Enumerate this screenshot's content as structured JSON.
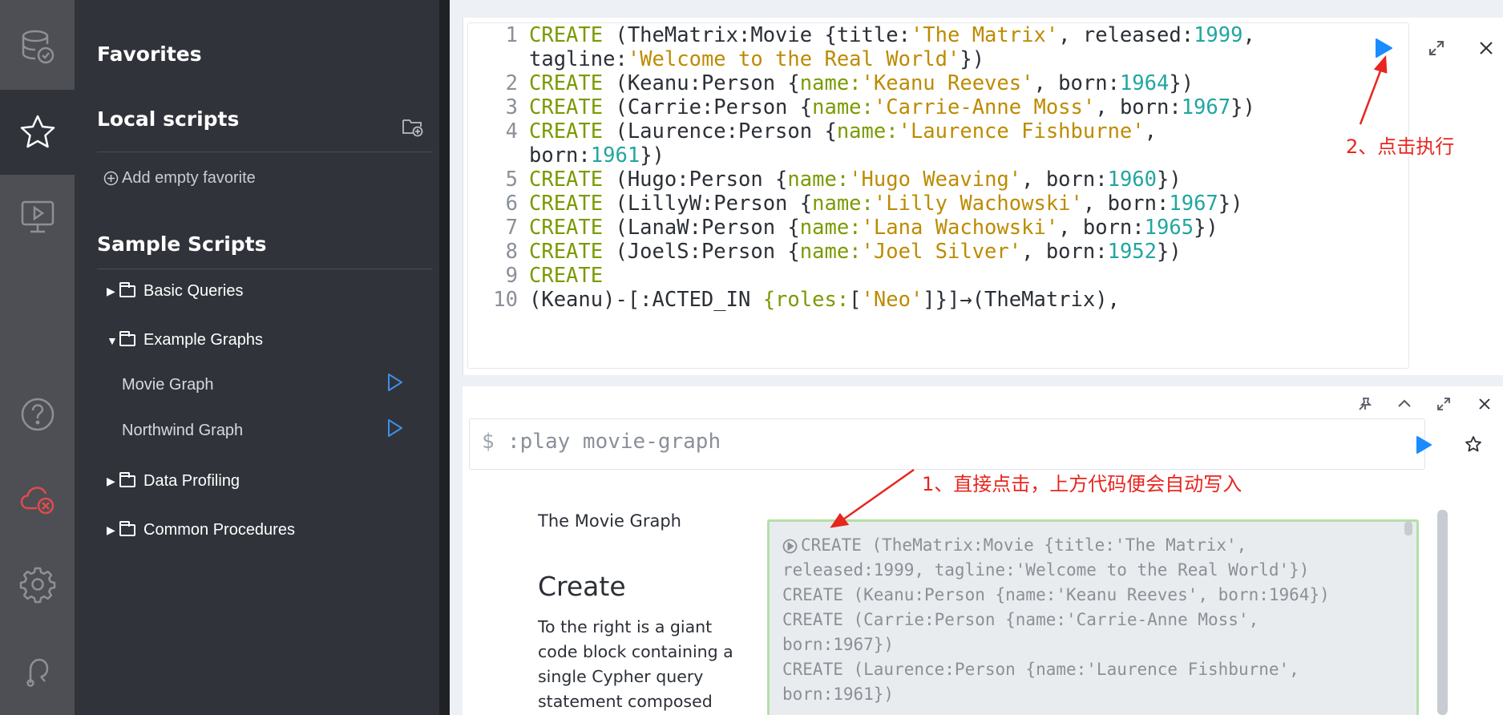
{
  "sidebar": {
    "favorites_title": "Favorites",
    "local_scripts_title": "Local scripts",
    "add_empty_favorite": "Add empty favorite",
    "sample_scripts_title": "Sample Scripts",
    "folders": [
      {
        "label": "Basic Queries",
        "expanded": false
      },
      {
        "label": "Example Graphs",
        "expanded": true
      },
      {
        "label": "Data Profiling",
        "expanded": false
      },
      {
        "label": "Common Procedures",
        "expanded": false
      }
    ],
    "scripts": [
      {
        "label": "Movie Graph"
      },
      {
        "label": "Northwind Graph"
      }
    ]
  },
  "rail": {
    "icons": [
      "database-icon",
      "star-icon",
      "monitor-play-icon",
      "help-icon",
      "cloud-disconnected-icon",
      "settings-gear-icon",
      "plug-icon"
    ],
    "active": "star-icon",
    "alert_color": "#e34b4b"
  },
  "editor": {
    "lines": [
      {
        "n": "1",
        "parts": [
          [
            "kw",
            "CREATE"
          ],
          [
            "t",
            " (TheMatrix:Movie {title:"
          ],
          [
            "str",
            "'The Matrix'"
          ],
          [
            "t",
            ", released:"
          ],
          [
            "num",
            "1999"
          ],
          [
            "t",
            ","
          ]
        ]
      },
      {
        "n": "",
        "parts": [
          [
            "t",
            "tagline:"
          ],
          [
            "str",
            "'Welcome to the Real World'"
          ],
          [
            "t",
            "})"
          ]
        ]
      },
      {
        "n": "2",
        "parts": [
          [
            "kw",
            "CREATE"
          ],
          [
            "t",
            " (Keanu:Person {"
          ],
          [
            "key",
            "name:"
          ],
          [
            "str",
            "'Keanu Reeves'"
          ],
          [
            "t",
            ", born:"
          ],
          [
            "num",
            "1964"
          ],
          [
            "t",
            "})"
          ]
        ]
      },
      {
        "n": "3",
        "parts": [
          [
            "kw",
            "CREATE"
          ],
          [
            "t",
            " (Carrie:Person {"
          ],
          [
            "key",
            "name:"
          ],
          [
            "str",
            "'Carrie-Anne Moss'"
          ],
          [
            "t",
            ", born:"
          ],
          [
            "num",
            "1967"
          ],
          [
            "t",
            "})"
          ]
        ]
      },
      {
        "n": "4",
        "parts": [
          [
            "kw",
            "CREATE"
          ],
          [
            "t",
            " (Laurence:Person {"
          ],
          [
            "key",
            "name:"
          ],
          [
            "str",
            "'Laurence Fishburne'"
          ],
          [
            "t",
            ","
          ]
        ]
      },
      {
        "n": "",
        "parts": [
          [
            "t",
            "born:"
          ],
          [
            "num",
            "1961"
          ],
          [
            "t",
            "})"
          ]
        ]
      },
      {
        "n": "5",
        "parts": [
          [
            "kw",
            "CREATE"
          ],
          [
            "t",
            " (Hugo:Person {"
          ],
          [
            "key",
            "name:"
          ],
          [
            "str",
            "'Hugo Weaving'"
          ],
          [
            "t",
            ", born:"
          ],
          [
            "num",
            "1960"
          ],
          [
            "t",
            "})"
          ]
        ]
      },
      {
        "n": "6",
        "parts": [
          [
            "kw",
            "CREATE"
          ],
          [
            "t",
            " (LillyW:Person {"
          ],
          [
            "key",
            "name:"
          ],
          [
            "str",
            "'Lilly Wachowski'"
          ],
          [
            "t",
            ", born:"
          ],
          [
            "num",
            "1967"
          ],
          [
            "t",
            "})"
          ]
        ]
      },
      {
        "n": "7",
        "parts": [
          [
            "kw",
            "CREATE"
          ],
          [
            "t",
            " (LanaW:Person {"
          ],
          [
            "key",
            "name:"
          ],
          [
            "str",
            "'Lana Wachowski'"
          ],
          [
            "t",
            ", born:"
          ],
          [
            "num",
            "1965"
          ],
          [
            "t",
            "})"
          ]
        ]
      },
      {
        "n": "8",
        "parts": [
          [
            "kw",
            "CREATE"
          ],
          [
            "t",
            " (JoelS:Person {"
          ],
          [
            "key",
            "name:"
          ],
          [
            "str",
            "'Joel Silver'"
          ],
          [
            "t",
            ", born:"
          ],
          [
            "num",
            "1952"
          ],
          [
            "t",
            "})"
          ]
        ]
      },
      {
        "n": "9",
        "parts": [
          [
            "kw",
            "CREATE"
          ]
        ]
      },
      {
        "n": "10",
        "parts": [
          [
            "t",
            "(Keanu)-[:ACTED_IN "
          ],
          [
            "key",
            "{roles:"
          ],
          [
            "t",
            "["
          ],
          [
            "str",
            "'Neo'"
          ],
          [
            "t",
            "]}]→(TheMatrix),"
          ]
        ]
      }
    ],
    "run_color": "#1a8cff"
  },
  "command": {
    "prompt": "$",
    "text": ":play movie-graph"
  },
  "guide": {
    "heading": "The Movie Graph",
    "create_title": "Create",
    "paragraph_lines": [
      "To the right is a giant",
      "code block containing a",
      "single Cypher query",
      "statement composed"
    ],
    "code_lines": [
      "CREATE (TheMatrix:Movie {title:'The Matrix',",
      "released:1999, tagline:'Welcome to the Real World'})",
      "CREATE (Keanu:Person {name:'Keanu Reeves', born:1964})",
      "CREATE (Carrie:Person {name:'Carrie-Anne Moss',",
      "born:1967})",
      "CREATE (Laurence:Person {name:'Laurence Fishburne',",
      "born:1961})"
    ]
  },
  "annotations": {
    "step2": "2、点击执行",
    "step1": "1、直接点击，上方代码便会自动写入",
    "color": "#e8251f"
  }
}
